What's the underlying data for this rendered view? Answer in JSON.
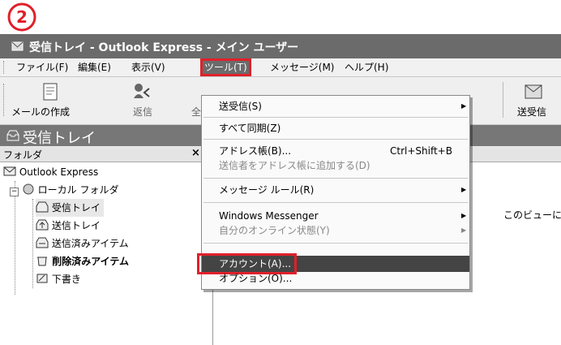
{
  "step_marker": "②",
  "window": {
    "title": "受信トレイ - Outlook Express - メイン ユーザー"
  },
  "menubar": [
    {
      "label": "ファイル(F)"
    },
    {
      "label": "編集(E)"
    },
    {
      "label": "表示(V)"
    },
    {
      "label": "ツール(T)"
    },
    {
      "label": "メッセージ(M)"
    },
    {
      "label": "ヘルプ(H)"
    }
  ],
  "toolbar": {
    "compose": "メールの作成",
    "reply": "返信",
    "reply_all_partial": "全",
    "send_receive": "送受信"
  },
  "folder_header": "受信トレイ",
  "folder_pane": {
    "header": "フォルダ",
    "close": "×",
    "items": [
      {
        "label": "Outlook Express"
      },
      {
        "label": "ローカル フォルダ"
      },
      {
        "label": "受信トレイ"
      },
      {
        "label": "送信トレイ"
      },
      {
        "label": "送信済みアイテム"
      },
      {
        "label": "削除済みアイテム"
      },
      {
        "label": "下書き"
      }
    ]
  },
  "right_pane_text": "このビューには",
  "tools_menu": {
    "items": [
      {
        "label": "送受信(S)",
        "submenu": "▶"
      },
      {
        "label": "すべて同期(Z)"
      },
      {
        "label": "アドレス帳(B)...",
        "shortcut": "Ctrl+Shift+B"
      },
      {
        "label": "送信者をアドレス帳に追加する(D)"
      },
      {
        "label": "メッセージ ルール(R)",
        "submenu": "▶"
      },
      {
        "label": "Windows Messenger",
        "submenu": "▶"
      },
      {
        "label": "自分のオンライン状態(Y)",
        "submenu": "▶"
      },
      {
        "label": "アカウント(A)..."
      },
      {
        "label": "オプション(O)..."
      }
    ]
  },
  "colors": {
    "highlight": "#e0202a",
    "title_bg": "#6b6b6b"
  }
}
